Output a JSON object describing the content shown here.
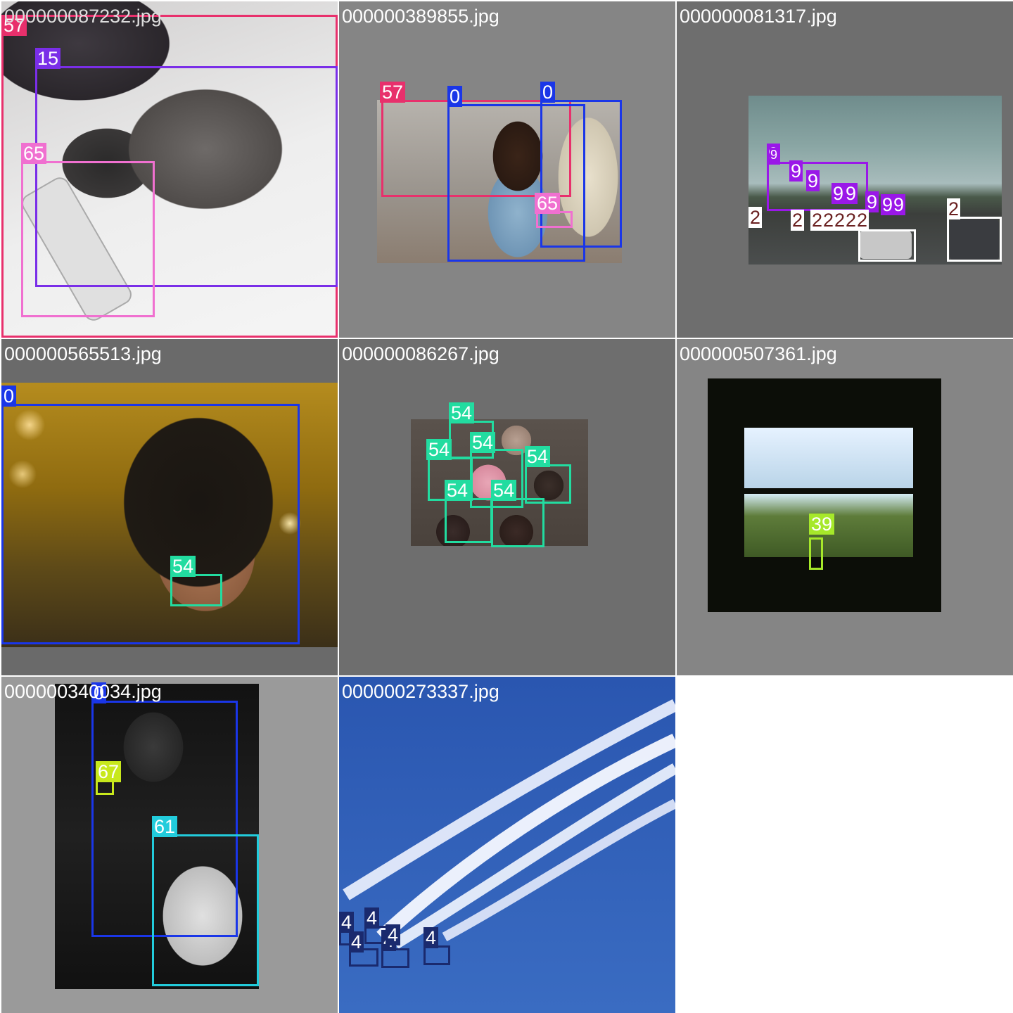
{
  "tiles": [
    {
      "filename": "000000087232.jpg",
      "image_description": "cat sleeping on remote control",
      "detections": [
        {
          "label": "57",
          "color": "#e8306c"
        },
        {
          "label": "15",
          "color": "#7a2ee8"
        },
        {
          "label": "65",
          "color": "#f070d0"
        }
      ]
    },
    {
      "filename": "000000389855.jpg",
      "image_description": "girl in blue dress near couch",
      "detections": [
        {
          "label": "57",
          "color": "#e8306c"
        },
        {
          "label": "0",
          "color": "#1a36e8"
        },
        {
          "label": "0",
          "color": "#1a36e8"
        },
        {
          "label": "65",
          "color": "#f070d0"
        }
      ]
    },
    {
      "filename": "000000081317.jpg",
      "image_description": "street with traffic lights and cars",
      "detections": [
        {
          "label": "9",
          "color": "#9a18e8"
        },
        {
          "label": "9",
          "color": "#9a18e8"
        },
        {
          "label": "9",
          "color": "#9a18e8"
        },
        {
          "label": "9",
          "color": "#9a18e8"
        },
        {
          "label": "9",
          "color": "#9a18e8"
        },
        {
          "label": "9",
          "color": "#9a18e8"
        },
        {
          "label": "9",
          "color": "#9a18e8"
        },
        {
          "label": "9",
          "color": "#9a18e8"
        },
        {
          "label": "9",
          "color": "#9a18e8"
        },
        {
          "label": "2",
          "color": "#ffffff"
        },
        {
          "label": "2",
          "color": "#ffffff"
        },
        {
          "label": "2",
          "color": "#ffffff"
        },
        {
          "label": "2",
          "color": "#ffffff"
        },
        {
          "label": "2",
          "color": "#ffffff"
        },
        {
          "label": "2",
          "color": "#ffffff"
        },
        {
          "label": "2",
          "color": "#ffffff"
        },
        {
          "label": "2",
          "color": "#ffffff"
        }
      ]
    },
    {
      "filename": "000000565513.jpg",
      "image_description": "woman with glasses eating donut",
      "detections": [
        {
          "label": "0",
          "color": "#1a36e8"
        },
        {
          "label": "54",
          "color": "#22dca0"
        }
      ]
    },
    {
      "filename": "000000086267.jpg",
      "image_description": "donuts on wooden table",
      "detections": [
        {
          "label": "54",
          "color": "#22dca0"
        },
        {
          "label": "54",
          "color": "#22dca0"
        },
        {
          "label": "54",
          "color": "#22dca0"
        },
        {
          "label": "54",
          "color": "#22dca0"
        },
        {
          "label": "54",
          "color": "#22dca0"
        },
        {
          "label": "54",
          "color": "#22dca0"
        }
      ]
    },
    {
      "filename": "000000507361.jpg",
      "image_description": "bottle on train window sill",
      "detections": [
        {
          "label": "39",
          "color": "#a6e82a"
        }
      ]
    },
    {
      "filename": "000000340034.jpg",
      "image_description": "child sitting on toilet with phone",
      "detections": [
        {
          "label": "0",
          "color": "#1a36e8"
        },
        {
          "label": "67",
          "color": "#c8e81c"
        },
        {
          "label": "61",
          "color": "#22ccdc"
        }
      ]
    },
    {
      "filename": "000000273337.jpg",
      "image_description": "jets flying with smoke trails",
      "detections": [
        {
          "label": "4",
          "color": "#1a2a6e"
        },
        {
          "label": "4",
          "color": "#1a2a6e"
        },
        {
          "label": "4",
          "color": "#1a2a6e"
        },
        {
          "label": "4",
          "color": "#1a2a6e"
        },
        {
          "label": "4",
          "color": "#1a2a6e"
        },
        {
          "label": "4",
          "color": "#1a2a6e"
        }
      ]
    }
  ]
}
